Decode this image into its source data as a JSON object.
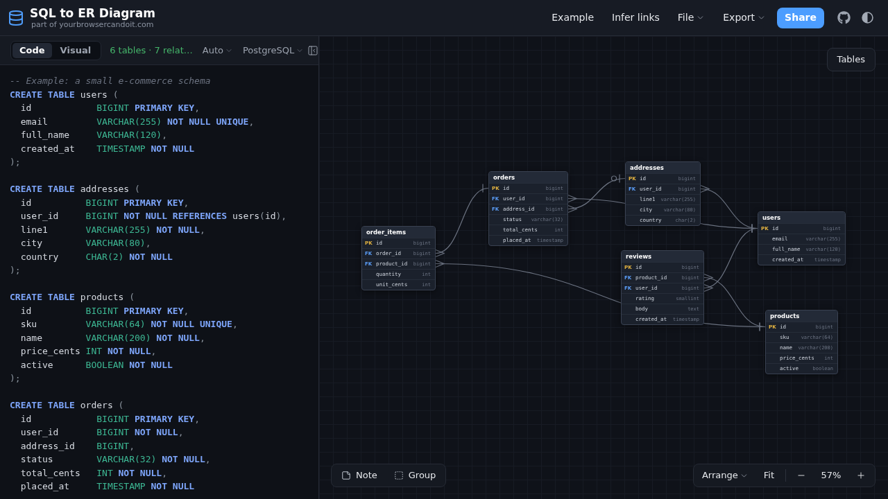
{
  "header": {
    "title": "SQL to ER Diagram",
    "subtitle": "part of yourbrowsercandoit.com",
    "nav": [
      {
        "label": "Example",
        "kind": "link"
      },
      {
        "label": "Infer links",
        "kind": "link"
      },
      {
        "label": "File",
        "kind": "menu"
      },
      {
        "label": "Export",
        "kind": "menu"
      },
      {
        "label": "Share",
        "kind": "primary"
      }
    ]
  },
  "editor_toolbar": {
    "tabs": [
      {
        "label": "Code",
        "selected": true
      },
      {
        "label": "Visual",
        "selected": false
      }
    ],
    "summary": "6 tables · 7 relat…",
    "menus": [
      "Auto",
      "PostgreSQL"
    ]
  },
  "code": {
    "blocks": [
      [
        [
          {
            "kind": "comment",
            "text": "-- Example: a small e-commerce schema"
          }
        ],
        [
          {
            "kind": "keyword",
            "text": "CREATE TABLE"
          },
          {
            "kind": "name",
            "text": " users "
          },
          {
            "kind": "punct",
            "text": "("
          }
        ],
        [
          {
            "kind": "name",
            "text": "  id            "
          },
          {
            "kind": "type",
            "text": "BIGINT"
          },
          {
            "kind": "keyword",
            "text": " PRIMARY KEY"
          },
          {
            "kind": "punct",
            "text": ","
          }
        ],
        [
          {
            "kind": "name",
            "text": "  email         "
          },
          {
            "kind": "type",
            "text": "VARCHAR(255)"
          },
          {
            "kind": "keyword",
            "text": " NOT NULL UNIQUE"
          },
          {
            "kind": "punct",
            "text": ","
          }
        ],
        [
          {
            "kind": "name",
            "text": "  full_name     "
          },
          {
            "kind": "type",
            "text": "VARCHAR(120)"
          },
          {
            "kind": "punct",
            "text": ","
          }
        ],
        [
          {
            "kind": "name",
            "text": "  created_at    "
          },
          {
            "kind": "type",
            "text": "TIMESTAMP"
          },
          {
            "kind": "keyword",
            "text": " NOT NULL"
          }
        ],
        [
          {
            "kind": "punct",
            "text": ");"
          }
        ]
      ],
      [
        [
          {
            "kind": "keyword",
            "text": "CREATE TABLE"
          },
          {
            "kind": "name",
            "text": " addresses "
          },
          {
            "kind": "punct",
            "text": "("
          }
        ],
        [
          {
            "kind": "name",
            "text": "  id          "
          },
          {
            "kind": "type",
            "text": "BIGINT"
          },
          {
            "kind": "keyword",
            "text": " PRIMARY KEY"
          },
          {
            "kind": "punct",
            "text": ","
          }
        ],
        [
          {
            "kind": "name",
            "text": "  user_id     "
          },
          {
            "kind": "type",
            "text": "BIGINT"
          },
          {
            "kind": "keyword",
            "text": " NOT NULL REFERENCES"
          },
          {
            "kind": "name",
            "text": " users"
          },
          {
            "kind": "punct",
            "text": "("
          },
          {
            "kind": "name",
            "text": "id"
          },
          {
            "kind": "punct",
            "text": "),"
          }
        ],
        [
          {
            "kind": "name",
            "text": "  line1       "
          },
          {
            "kind": "type",
            "text": "VARCHAR(255)"
          },
          {
            "kind": "keyword",
            "text": " NOT NULL"
          },
          {
            "kind": "punct",
            "text": ","
          }
        ],
        [
          {
            "kind": "name",
            "text": "  city        "
          },
          {
            "kind": "type",
            "text": "VARCHAR(80)"
          },
          {
            "kind": "punct",
            "text": ","
          }
        ],
        [
          {
            "kind": "name",
            "text": "  country     "
          },
          {
            "kind": "type",
            "text": "CHAR(2)"
          },
          {
            "kind": "keyword",
            "text": " NOT NULL"
          }
        ],
        [
          {
            "kind": "punct",
            "text": ");"
          }
        ]
      ],
      [
        [
          {
            "kind": "keyword",
            "text": "CREATE TABLE"
          },
          {
            "kind": "name",
            "text": " products "
          },
          {
            "kind": "punct",
            "text": "("
          }
        ],
        [
          {
            "kind": "name",
            "text": "  id          "
          },
          {
            "kind": "type",
            "text": "BIGINT"
          },
          {
            "kind": "keyword",
            "text": " PRIMARY KEY"
          },
          {
            "kind": "punct",
            "text": ","
          }
        ],
        [
          {
            "kind": "name",
            "text": "  sku         "
          },
          {
            "kind": "type",
            "text": "VARCHAR(64)"
          },
          {
            "kind": "keyword",
            "text": " NOT NULL UNIQUE"
          },
          {
            "kind": "punct",
            "text": ","
          }
        ],
        [
          {
            "kind": "name",
            "text": "  name        "
          },
          {
            "kind": "type",
            "text": "VARCHAR(200)"
          },
          {
            "kind": "keyword",
            "text": " NOT NULL"
          },
          {
            "kind": "punct",
            "text": ","
          }
        ],
        [
          {
            "kind": "name",
            "text": "  price_cents "
          },
          {
            "kind": "type",
            "text": "INT"
          },
          {
            "kind": "keyword",
            "text": " NOT NULL"
          },
          {
            "kind": "punct",
            "text": ","
          }
        ],
        [
          {
            "kind": "name",
            "text": "  active      "
          },
          {
            "kind": "type",
            "text": "BOOLEAN"
          },
          {
            "kind": "keyword",
            "text": " NOT NULL"
          }
        ],
        [
          {
            "kind": "punct",
            "text": ");"
          }
        ]
      ],
      [
        [
          {
            "kind": "keyword",
            "text": "CREATE TABLE"
          },
          {
            "kind": "name",
            "text": " orders "
          },
          {
            "kind": "punct",
            "text": "("
          }
        ],
        [
          {
            "kind": "name",
            "text": "  id            "
          },
          {
            "kind": "type",
            "text": "BIGINT"
          },
          {
            "kind": "keyword",
            "text": " PRIMARY KEY"
          },
          {
            "kind": "punct",
            "text": ","
          }
        ],
        [
          {
            "kind": "name",
            "text": "  user_id       "
          },
          {
            "kind": "type",
            "text": "BIGINT"
          },
          {
            "kind": "keyword",
            "text": " NOT NULL"
          },
          {
            "kind": "punct",
            "text": ","
          }
        ],
        [
          {
            "kind": "name",
            "text": "  address_id    "
          },
          {
            "kind": "type",
            "text": "BIGINT"
          },
          {
            "kind": "punct",
            "text": ","
          }
        ],
        [
          {
            "kind": "name",
            "text": "  status        "
          },
          {
            "kind": "type",
            "text": "VARCHAR(32)"
          },
          {
            "kind": "keyword",
            "text": " NOT NULL"
          },
          {
            "kind": "punct",
            "text": ","
          }
        ],
        [
          {
            "kind": "name",
            "text": "  total_cents   "
          },
          {
            "kind": "type",
            "text": "INT"
          },
          {
            "kind": "keyword",
            "text": " NOT NULL"
          },
          {
            "kind": "punct",
            "text": ","
          }
        ],
        [
          {
            "kind": "name",
            "text": "  placed_at     "
          },
          {
            "kind": "type",
            "text": "TIMESTAMP"
          },
          {
            "kind": "keyword",
            "text": " NOT NULL"
          }
        ]
      ]
    ]
  },
  "canvas": {
    "tables_button": "Tables",
    "tables": [
      {
        "name": "order_items",
        "columns": [
          {
            "kind": "pk",
            "badge": "PK",
            "name": "id",
            "type": "bigint"
          },
          {
            "kind": "fk",
            "badge": "FK",
            "name": "order_id",
            "type": "bigint"
          },
          {
            "kind": "fk",
            "badge": "FK",
            "name": "product_id",
            "type": "bigint"
          },
          {
            "kind": "plain",
            "name": "quantity",
            "type": "int"
          },
          {
            "kind": "plain",
            "name": "unit_cents",
            "type": "int"
          }
        ]
      },
      {
        "name": "orders",
        "columns": [
          {
            "kind": "pk",
            "badge": "PK",
            "name": "id",
            "type": "bigint"
          },
          {
            "kind": "fk",
            "badge": "FK",
            "name": "user_id",
            "type": "bigint"
          },
          {
            "kind": "fk",
            "badge": "FK",
            "name": "address_id",
            "type": "bigint"
          },
          {
            "kind": "plain",
            "name": "status",
            "type": "varchar(32)"
          },
          {
            "kind": "plain",
            "name": "total_cents",
            "type": "int"
          },
          {
            "kind": "plain",
            "name": "placed_at",
            "type": "timestamp"
          }
        ]
      },
      {
        "name": "addresses",
        "columns": [
          {
            "kind": "pk",
            "badge": "PK",
            "name": "id",
            "type": "bigint"
          },
          {
            "kind": "fk",
            "badge": "FK",
            "name": "user_id",
            "type": "bigint"
          },
          {
            "kind": "plain",
            "name": "line1",
            "type": "varchar(255)"
          },
          {
            "kind": "plain",
            "name": "city",
            "type": "varchar(80)"
          },
          {
            "kind": "plain",
            "name": "country",
            "type": "char(2)"
          }
        ]
      },
      {
        "name": "users",
        "columns": [
          {
            "kind": "pk",
            "badge": "PK",
            "name": "id",
            "type": "bigint"
          },
          {
            "kind": "plain",
            "name": "email",
            "type": "varchar(255)"
          },
          {
            "kind": "plain",
            "name": "full_name",
            "type": "varchar(120)"
          },
          {
            "kind": "plain",
            "name": "created_at",
            "type": "timestamp"
          }
        ]
      },
      {
        "name": "reviews",
        "columns": [
          {
            "kind": "pk",
            "badge": "PK",
            "name": "id",
            "type": "bigint"
          },
          {
            "kind": "fk",
            "badge": "FK",
            "name": "product_id",
            "type": "bigint"
          },
          {
            "kind": "fk",
            "badge": "FK",
            "name": "user_id",
            "type": "bigint"
          },
          {
            "kind": "plain",
            "name": "rating",
            "type": "smallint"
          },
          {
            "kind": "plain",
            "name": "body",
            "type": "text"
          },
          {
            "kind": "plain",
            "name": "created_at",
            "type": "timestamp"
          }
        ]
      },
      {
        "name": "products",
        "columns": [
          {
            "kind": "pk",
            "badge": "PK",
            "name": "id",
            "type": "bigint"
          },
          {
            "kind": "plain",
            "name": "sku",
            "type": "varchar(64)"
          },
          {
            "kind": "plain",
            "name": "name",
            "type": "varchar(200)"
          },
          {
            "kind": "plain",
            "name": "price_cents",
            "type": "int"
          },
          {
            "kind": "plain",
            "name": "active",
            "type": "boolean"
          }
        ]
      }
    ],
    "relationships": [
      {
        "kind": "one"
      },
      {
        "kind": "one"
      },
      {
        "kind": "one"
      },
      {
        "kind": "zero_or_one"
      },
      {
        "kind": "one"
      },
      {
        "kind": "one"
      },
      {
        "kind": "one"
      }
    ],
    "tools": [
      {
        "label": "Note",
        "kind": "note"
      },
      {
        "label": "Group",
        "kind": "group"
      }
    ],
    "view_controls": {
      "arrange": "Arrange",
      "fit": "Fit",
      "zoom": "57%"
    }
  }
}
